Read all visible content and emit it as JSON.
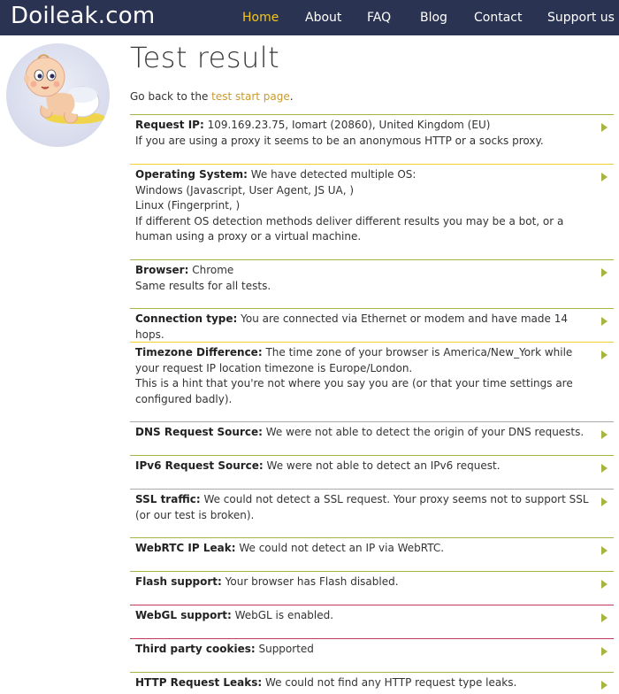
{
  "nav": {
    "logo": "Doileak.com",
    "items": [
      {
        "label": "Home",
        "active": true
      },
      {
        "label": "About"
      },
      {
        "label": "FAQ"
      },
      {
        "label": "Blog"
      },
      {
        "label": "Contact"
      },
      {
        "label": "Support us"
      }
    ]
  },
  "colors": {
    "navbar_bg": "#2b3352",
    "nav_active": "#f2c61f",
    "link": "#c99a2e",
    "line_green": "#a8b440",
    "line_yellow": "#f2d231",
    "line_gray": "#aaaaaa",
    "line_red": "#c0395a"
  },
  "page": {
    "title": "Test result",
    "back_prefix": "Go back to the ",
    "back_link": "test start page",
    "back_suffix": "."
  },
  "results": [
    {
      "label": "Request IP:",
      "lines": [
        " 109.169.23.75, Iomart (20860), United Kingdom (EU)",
        "If you are using a proxy it seems to be an anonymous HTTP or a socks proxy."
      ],
      "line_color": "green"
    },
    {
      "label": "Operating System:",
      "lines": [
        " We have detected multiple OS:",
        "Windows (Javascript, User Agent, JS UA, )",
        "Linux (Fingerprint, )",
        "If different OS detection methods deliver different results you may be a bot, or a human using a proxy or a virtual machine."
      ],
      "line_color": "yellow"
    },
    {
      "label": "Browser:",
      "lines": [
        " Chrome",
        "Same results for all tests."
      ],
      "line_color": "green"
    },
    {
      "label": "Connection type:",
      "lines": [
        " You are connected via Ethernet or modem and have made 14 hops."
      ],
      "line_color": "green"
    },
    {
      "label": "Timezone Difference:",
      "lines": [
        " The time zone of your browser is America/New_York while your request IP location timezone is Europe/London.",
        "This is a hint that you're not where you say you are (or that your time settings are configured badly)."
      ],
      "line_color": "yellow"
    },
    {
      "label": "DNS Request Source:",
      "lines": [
        " We were not able to detect the origin of your DNS requests."
      ],
      "line_color": "gray"
    },
    {
      "label": "IPv6 Request Source:",
      "lines": [
        " We were not able to detect an IPv6 request."
      ],
      "line_color": "green"
    },
    {
      "label": "SSL traffic:",
      "lines": [
        " We could not detect a SSL request. Your proxy seems not to support SSL (or our test is broken)."
      ],
      "line_color": "gray"
    },
    {
      "label": "WebRTC IP Leak:",
      "lines": [
        " We could not detect an IP via WebRTC."
      ],
      "line_color": "green"
    },
    {
      "label": "Flash support:",
      "lines": [
        " Your browser has Flash disabled."
      ],
      "line_color": "green"
    },
    {
      "label": "WebGL support:",
      "lines": [
        " WebGL is enabled."
      ],
      "line_color": "red"
    },
    {
      "label": "Third party cookies:",
      "lines": [
        " Supported"
      ],
      "line_color": "red"
    },
    {
      "label": "HTTP Request Leaks:",
      "lines": [
        " We could not find any HTTP request type leaks."
      ],
      "line_color": "green"
    }
  ]
}
